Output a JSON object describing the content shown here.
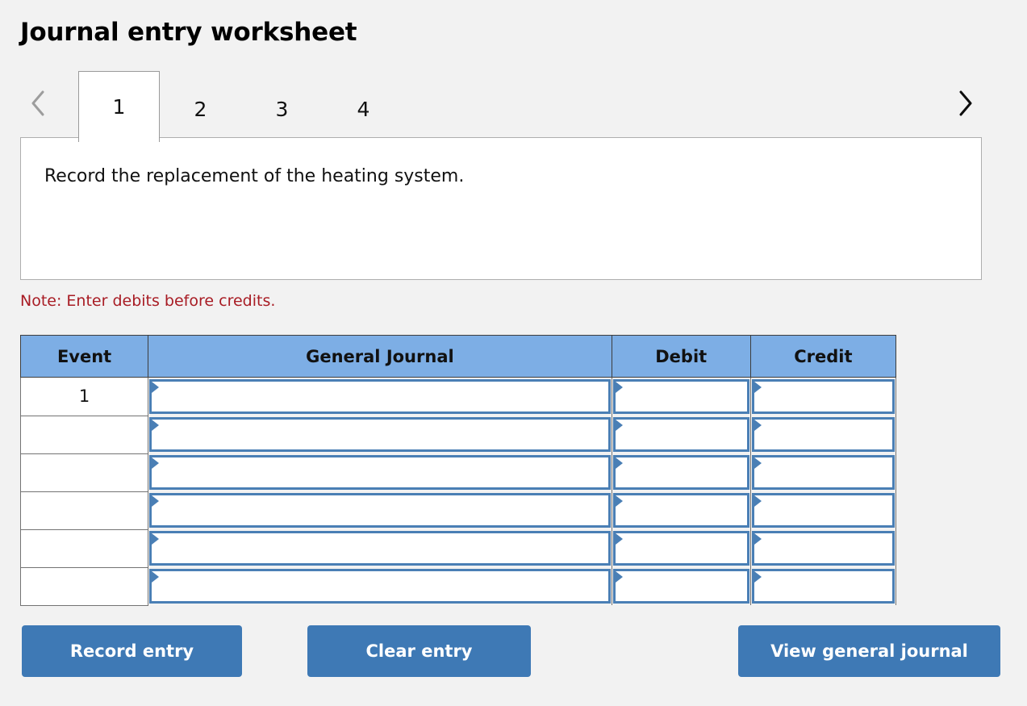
{
  "header": {
    "title": "Journal entry worksheet"
  },
  "tabs": {
    "prev_icon": "chevron-left-icon",
    "next_icon": "chevron-right-icon",
    "prev_enabled": false,
    "next_enabled": true,
    "active_index": 0,
    "items": [
      {
        "label": "1",
        "active": true
      },
      {
        "label": "2",
        "active": false
      },
      {
        "label": "3",
        "active": false
      },
      {
        "label": "4",
        "active": false
      }
    ]
  },
  "scenario": {
    "text": "Record the replacement of the heating system."
  },
  "note": {
    "text": "Note: Enter debits before credits.",
    "color": "#a81c24"
  },
  "journal": {
    "columns": [
      "Event",
      "General Journal",
      "Debit",
      "Credit"
    ],
    "header_bg": "#7daee5",
    "cell_border": "#4a7fb5",
    "marker_icon": "triangle-right-icon",
    "rows": [
      {
        "event": "1",
        "general_journal": "",
        "debit": "",
        "credit": ""
      },
      {
        "event": "",
        "general_journal": "",
        "debit": "",
        "credit": ""
      },
      {
        "event": "",
        "general_journal": "",
        "debit": "",
        "credit": ""
      },
      {
        "event": "",
        "general_journal": "",
        "debit": "",
        "credit": ""
      },
      {
        "event": "",
        "general_journal": "",
        "debit": "",
        "credit": ""
      },
      {
        "event": "",
        "general_journal": "",
        "debit": "",
        "credit": ""
      }
    ]
  },
  "buttons": {
    "record": "Record entry",
    "clear": "Clear entry",
    "view": "View general journal",
    "accent": "#3e79b5"
  }
}
